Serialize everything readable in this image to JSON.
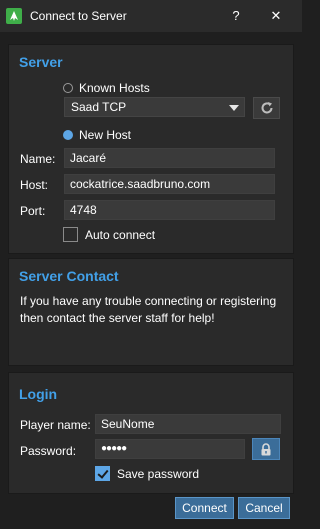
{
  "window": {
    "title": "Connect to Server",
    "help_glyph": "?",
    "close_glyph": "✕",
    "app_icon": "cockatrice-icon"
  },
  "server": {
    "section_title": "Server",
    "known_hosts_label": "Known Hosts",
    "known_hosts_selected": false,
    "known_host_value": "Saad TCP",
    "new_host_label": "New Host",
    "new_host_selected": true,
    "name_label": "Name:",
    "name_value": "Jacaré",
    "host_label": "Host:",
    "host_value": "cockatrice.saadbruno.com",
    "port_label": "Port:",
    "port_value": "4748",
    "auto_connect_label": "Auto connect",
    "auto_connect_checked": false
  },
  "contact": {
    "section_title": "Server Contact",
    "text": "If you have any trouble connecting or registering then contact the server staff for help!"
  },
  "login": {
    "section_title": "Login",
    "player_name_label": "Player name:",
    "player_name_value": "SeuNome",
    "password_label": "Password:",
    "password_masked": "●●●●●",
    "save_password_label": "Save password",
    "save_password_checked": true
  },
  "buttons": {
    "connect_label": "Connect",
    "cancel_label": "Cancel"
  },
  "colors": {
    "accent": "#42a0e8",
    "button": "#3b6d99",
    "background": "#1f1f1f",
    "panel": "#2a2a2a",
    "input": "#3a3a3a"
  }
}
